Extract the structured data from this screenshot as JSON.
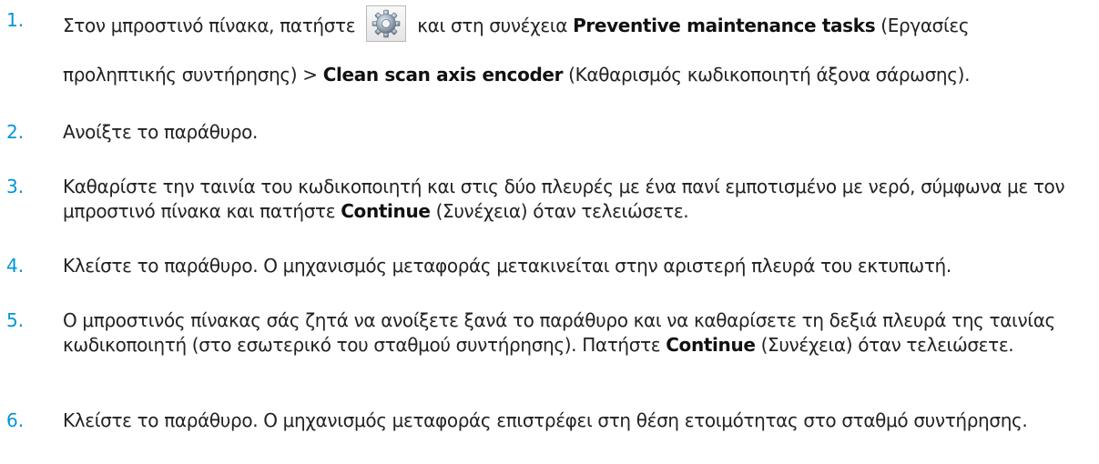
{
  "steps": [
    {
      "number": "1.",
      "t1": "Στον μπροστινό πίνακα, πατήστε",
      "t2": "και στη συνέχεια",
      "b1": "Preventive maintenance tasks",
      "t3": "(Εργασίες",
      "t4": "προληπτικής συντήρησης) >",
      "b2": "Clean scan axis encoder",
      "t5": "(Καθαρισμός κωδικοποιητή άξονα σάρωσης).",
      "icon": "settings-gear-icon"
    },
    {
      "number": "2.",
      "text": "Ανοίξτε το παράθυρο."
    },
    {
      "number": "3.",
      "t1": "Καθαρίστε την ταινία του κωδικοποιητή και στις δύο πλευρές με ένα πανί εμποτισμένο με νερό, σύμφωνα με τον μπροστινό πίνακα και πατήστε",
      "b1": "Continue",
      "t2": "(Συνέχεια) όταν τελειώσετε."
    },
    {
      "number": "4.",
      "text": "Κλείστε το παράθυρο. Ο μηχανισμός μεταφοράς μετακινείται στην αριστερή πλευρά του εκτυπωτή."
    },
    {
      "number": "5.",
      "t1": "Ο μπροστινός πίνακας σάς ζητά να ανοίξετε ξανά το παράθυρο και να καθαρίσετε τη δεξιά πλευρά της ταινίας κωδικοποιητή (στο εσωτερικό του σταθμού συντήρησης). Πατήστε",
      "b1": "Continue",
      "t2": "(Συνέχεια) όταν τελειώσετε."
    },
    {
      "number": "6.",
      "text": "Κλείστε το παράθυρο. Ο μηχανισμός μεταφοράς επιστρέφει στη θέση ετοιμότητας στο σταθμό συντήρησης."
    }
  ],
  "colors": {
    "step_number": "#0096d6",
    "text": "#222222"
  }
}
